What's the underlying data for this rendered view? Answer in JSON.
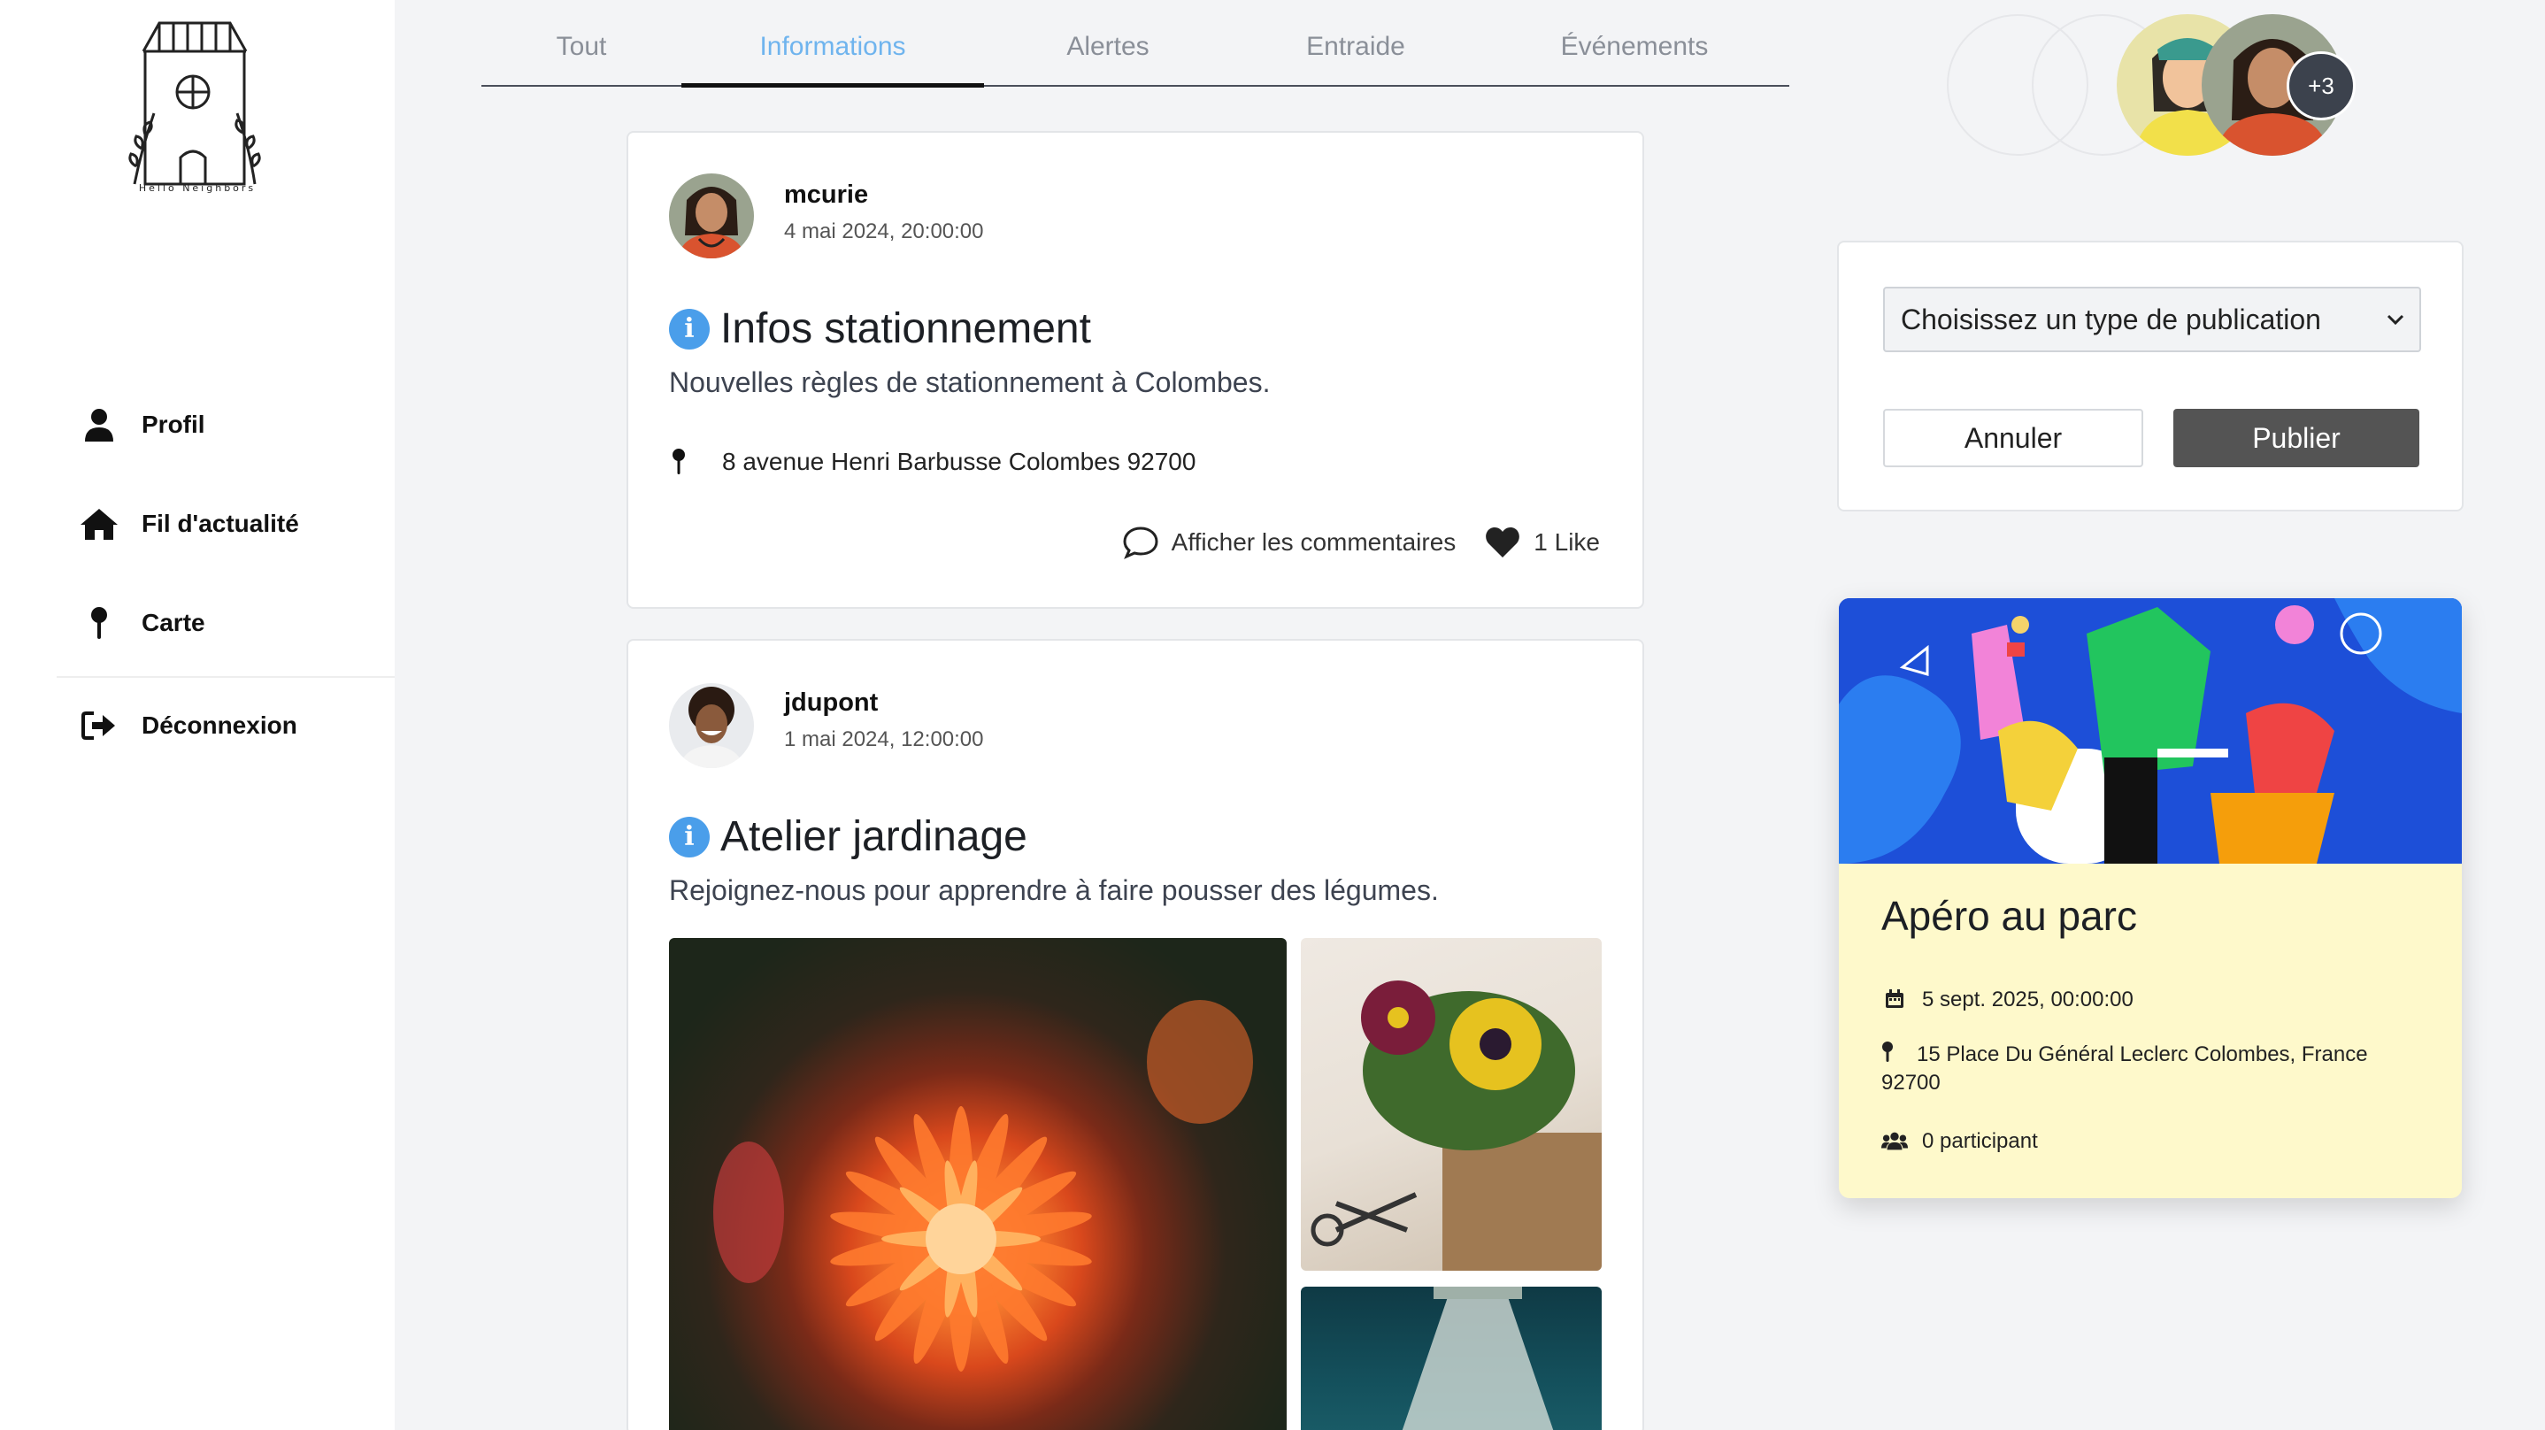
{
  "app": {
    "logo_text": "Hello Neighbors"
  },
  "sidebar": {
    "items": [
      {
        "label": "Profil",
        "icon": "user-icon"
      },
      {
        "label": "Fil d'actualité",
        "icon": "home-icon"
      },
      {
        "label": "Carte",
        "icon": "map-pin-icon"
      },
      {
        "label": "Déconnexion",
        "icon": "logout-icon"
      }
    ]
  },
  "tabs": [
    {
      "label": "Tout",
      "active": false
    },
    {
      "label": "Informations",
      "active": true
    },
    {
      "label": "Alertes",
      "active": false
    },
    {
      "label": "Entraide",
      "active": false
    },
    {
      "label": "Événements",
      "active": false
    }
  ],
  "posts": [
    {
      "author": "mcurie",
      "date": "4 mai 2024, 20:00:00",
      "title": "Infos stationnement",
      "description": "Nouvelles règles de stationnement à Colombes.",
      "address": "8 avenue Henri Barbusse Colombes 92700",
      "comments_label": "Afficher les commentaires",
      "likes_label": "1 Like"
    },
    {
      "author": "jdupont",
      "date": "1 mai 2024, 12:00:00",
      "title": "Atelier jardinage",
      "description": "Rejoignez-nous pour apprendre à faire pousser des légumes."
    }
  ],
  "participants": {
    "more": "+3"
  },
  "publish": {
    "select_value": "Choisissez un type de publication",
    "cancel_label": "Annuler",
    "publish_label": "Publier"
  },
  "event": {
    "title": "Apéro au parc",
    "date": "5 sept. 2025, 00:00:00",
    "address": "15 Place Du Général Leclerc Colombes, France 92700",
    "participants": "0 participant"
  },
  "colors": {
    "accent": "#6fb4ee",
    "info": "#4a9eea",
    "event_bg": "#fef9cb",
    "publish_btn": "#545454"
  }
}
